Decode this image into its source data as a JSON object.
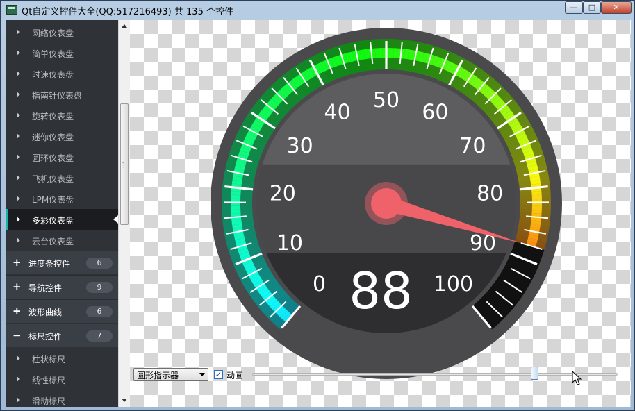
{
  "window": {
    "title": "Qt自定义控件大全(QQ:517216493) 共 135 个控件",
    "min_glyph": "—",
    "max_glyph": "□",
    "close_glyph": "✕"
  },
  "sidebar": {
    "children_top": [
      {
        "label": "网络仪表盘"
      },
      {
        "label": "简单仪表盘"
      },
      {
        "label": "时速仪表盘"
      },
      {
        "label": "指南针仪表盘"
      },
      {
        "label": "旋转仪表盘"
      },
      {
        "label": "迷你仪表盘"
      },
      {
        "label": "圆环仪表盘"
      },
      {
        "label": "飞机仪表盘"
      },
      {
        "label": "LPM仪表盘"
      },
      {
        "label": "多彩仪表盘",
        "selected": true
      },
      {
        "label": "云台仪表盘"
      }
    ],
    "groups": [
      {
        "sign": "+",
        "label": "进度条控件",
        "count": "6"
      },
      {
        "sign": "+",
        "label": "导航控件",
        "count": "9"
      },
      {
        "sign": "+",
        "label": "波形曲线",
        "count": "6"
      },
      {
        "sign": "−",
        "label": "标尺控件",
        "count": "7"
      }
    ],
    "children_bottom": [
      {
        "label": "柱状标尺"
      },
      {
        "label": "线性标尺"
      },
      {
        "label": "滑动标尺"
      }
    ]
  },
  "gauge": {
    "value": 88,
    "min": 0,
    "max": 100,
    "value_text": "88",
    "scale_labels": [
      "0",
      "10",
      "20",
      "30",
      "40",
      "50",
      "60",
      "70",
      "80",
      "90",
      "100"
    ],
    "colors": {
      "ring": "#4a4a4d",
      "bg_top": "#5d5d5f",
      "bg_mid": "#48484b",
      "bg_low": "#2e2e31",
      "bg_bottom": "#1c1c1e",
      "pointer": "#f0626a",
      "empty_track": "#111111"
    }
  },
  "controls": {
    "pointer_style": "圆形指示器",
    "animation_checked": true,
    "animation_label": "动画",
    "check_glyph": "✓",
    "slider_value": 88
  }
}
